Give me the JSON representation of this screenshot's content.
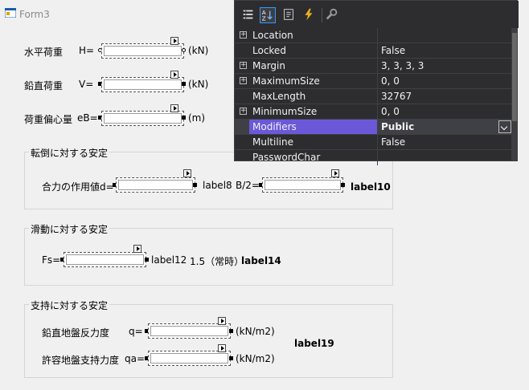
{
  "window": {
    "title": "Form3"
  },
  "top_rows": [
    {
      "label": "水平荷重",
      "var": "H=",
      "unit": "(kN)"
    },
    {
      "label": "鉛直荷重",
      "var": "V=",
      "unit": "(kN)"
    },
    {
      "label": "荷重偏心量",
      "var": "eB=",
      "unit": "(m)"
    }
  ],
  "group1": {
    "title": "転倒に対する安定",
    "field_label": "合力の作用値d=",
    "label8": "label8",
    "b2": "B/2=",
    "label10": "label10"
  },
  "group2": {
    "title": "滑動に対する安定",
    "field_label": "Fs=",
    "label12": "label12",
    "normal": "1.5（常時）",
    "label14": "label14"
  },
  "group3": {
    "title": "支持に対する安定",
    "row1_label": "鉛直地盤反力度",
    "row1_var": "q=",
    "row1_unit": "(kN/m2)",
    "row2_label": "許容地盤支持力度",
    "row2_var": "qa=",
    "row2_unit": "(kN/m2)",
    "label19": "label19"
  },
  "property_grid": {
    "rows": [
      {
        "name": "Location",
        "value": "",
        "expandable": true
      },
      {
        "name": "Locked",
        "value": "False",
        "expandable": false
      },
      {
        "name": "Margin",
        "value": "3, 3, 3, 3",
        "expandable": true
      },
      {
        "name": "MaximumSize",
        "value": "0, 0",
        "expandable": true
      },
      {
        "name": "MaxLength",
        "value": "32767",
        "expandable": false
      },
      {
        "name": "MinimumSize",
        "value": "0, 0",
        "expandable": true
      },
      {
        "name": "Modifiers",
        "value": "Public",
        "expandable": false,
        "selected": true
      },
      {
        "name": "Multiline",
        "value": "False",
        "expandable": false
      },
      {
        "name": "PasswordChar",
        "value": "",
        "expandable": false
      }
    ],
    "accent": "#6b58d8"
  }
}
